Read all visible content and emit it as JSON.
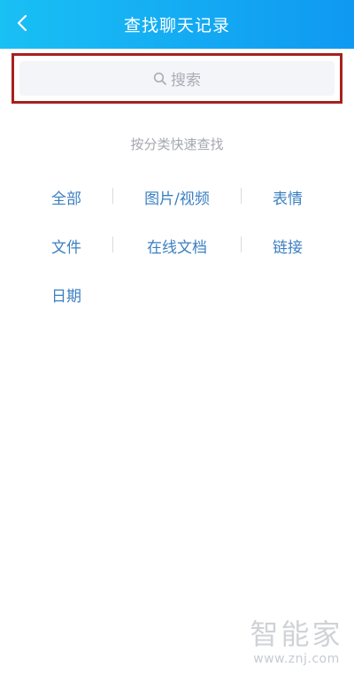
{
  "header": {
    "title": "查找聊天记录",
    "back_icon": "chevron-left-icon",
    "background_color": "#14aaf3"
  },
  "search": {
    "placeholder": "搜索",
    "icon": "search-icon",
    "highlight_color": "#a7201d"
  },
  "categories": {
    "heading": "按分类快速查找",
    "items": [
      {
        "label": "全部"
      },
      {
        "label": "图片/视频"
      },
      {
        "label": "表情"
      },
      {
        "label": "文件"
      },
      {
        "label": "在线文档"
      },
      {
        "label": "链接"
      },
      {
        "label": "日期"
      }
    ],
    "link_color": "#3b7fc2"
  },
  "watermark": {
    "brand": "智能家",
    "url": "www.znj.com"
  }
}
